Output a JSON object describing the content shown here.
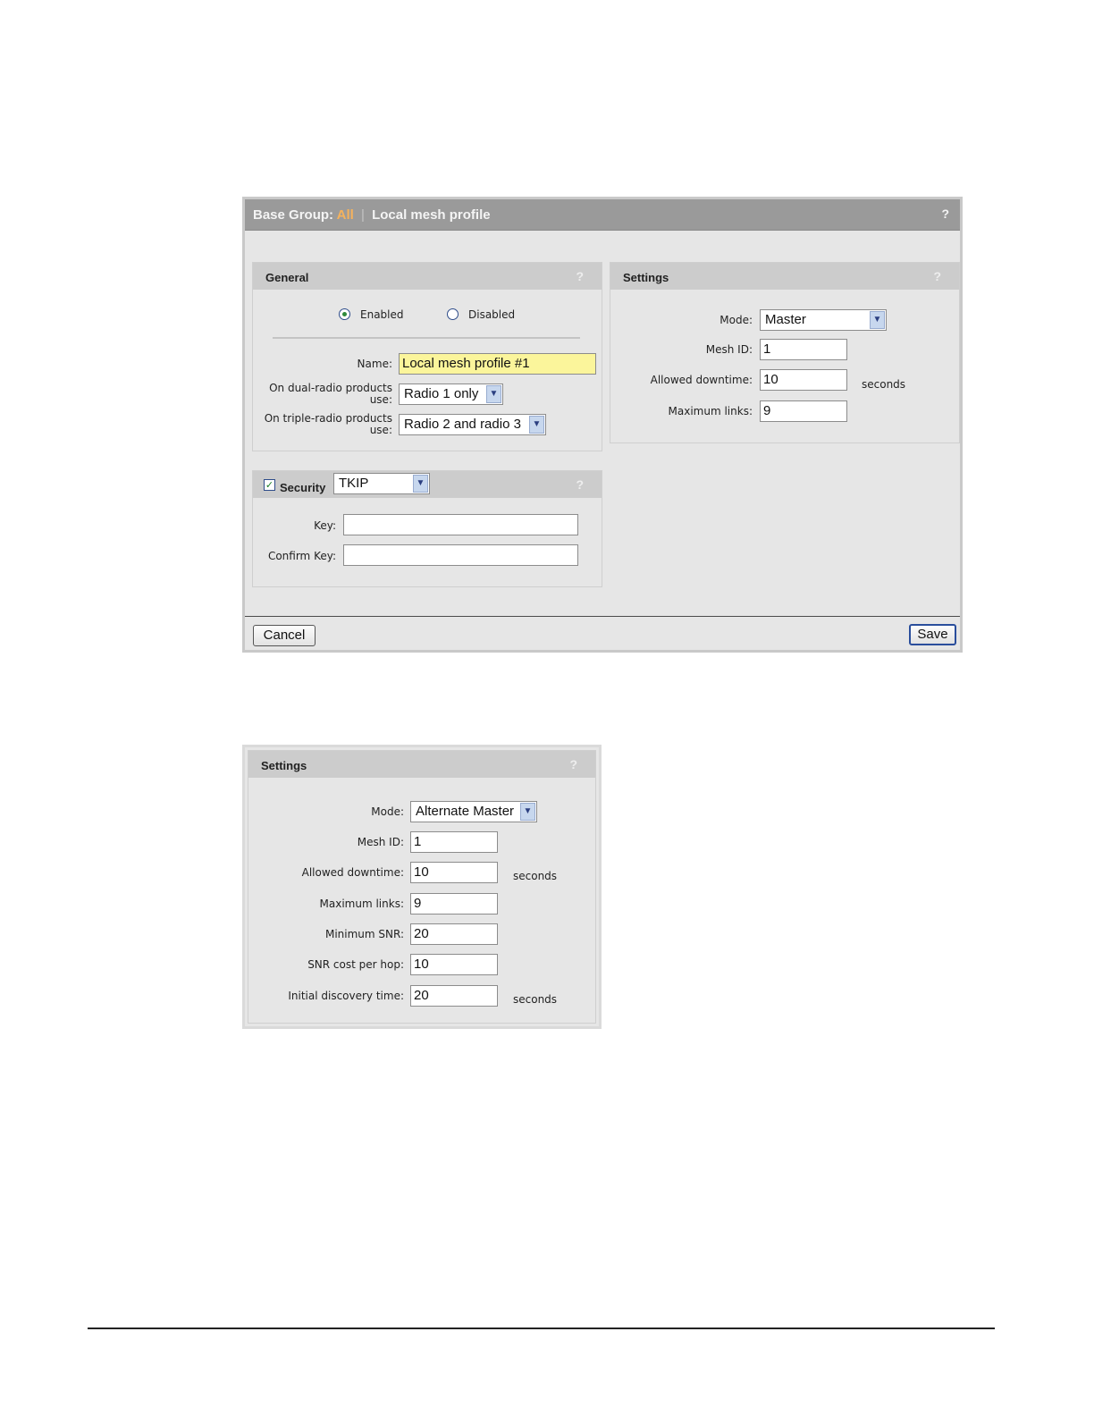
{
  "dialog": {
    "title_prefix": "Base Group:",
    "title_group": "All",
    "title_separator": "|",
    "title_page": "Local mesh profile",
    "help": "?",
    "cancel_label": "Cancel",
    "save_label": "Save"
  },
  "general": {
    "title": "General",
    "help": "?",
    "enabled_label": "Enabled",
    "disabled_label": "Disabled",
    "state": "Enabled",
    "name_label": "Name:",
    "name_value": "Local mesh profile #1",
    "dual_label_1": "On dual-radio products",
    "dual_label_2": "use:",
    "dual_value": "Radio 1 only",
    "triple_label_1": "On triple-radio products",
    "triple_label_2": "use:",
    "triple_value": "Radio 2 and radio 3"
  },
  "security": {
    "title": "Security",
    "checked": true,
    "check_mark": "✓",
    "type_value": "TKIP",
    "help": "?",
    "key_label": "Key:",
    "key_value": "",
    "confirm_label": "Confirm Key:",
    "confirm_value": ""
  },
  "settings": {
    "title": "Settings",
    "help": "?",
    "mode_label": "Mode:",
    "mode_value": "Master",
    "mesh_id_label": "Mesh ID:",
    "mesh_id_value": "1",
    "downtime_label": "Allowed downtime:",
    "downtime_value": "10",
    "downtime_unit": "seconds",
    "max_links_label": "Maximum links:",
    "max_links_value": "9"
  },
  "settings2": {
    "title": "Settings",
    "help": "?",
    "mode_label": "Mode:",
    "mode_value": "Alternate Master",
    "mesh_id_label": "Mesh ID:",
    "mesh_id_value": "1",
    "downtime_label": "Allowed downtime:",
    "downtime_value": "10",
    "downtime_unit": "seconds",
    "max_links_label": "Maximum links:",
    "max_links_value": "9",
    "min_snr_label": "Minimum SNR:",
    "min_snr_value": "20",
    "snr_cost_label": "SNR cost per hop:",
    "snr_cost_value": "10",
    "discovery_label": "Initial discovery time:",
    "discovery_value": "20",
    "discovery_unit": "seconds"
  },
  "icons": {
    "dropdown": "chevron-down-icon",
    "radio_selected_color": "#2e8a3a",
    "check_color": "#1a7d26"
  }
}
